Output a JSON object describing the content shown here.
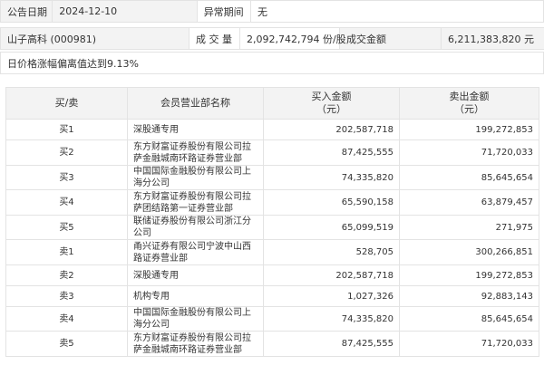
{
  "info": {
    "date_label": "公告日期",
    "date_value": "2024-12-10",
    "abnormal_label": "异常期间",
    "abnormal_value": "无",
    "stock_name": "山子高科 (000981)",
    "volume_label": "成 交 量",
    "volume_value": "2,092,742,794 份/股",
    "amount_label": "成交金额",
    "amount_value": "6,211,383,820 元",
    "reason": "日价格涨幅偏离值达到9.13%"
  },
  "table": {
    "headers": {
      "side": "买/卖",
      "broker": "会员营业部名称",
      "buy": "买入金额\n（元）",
      "sell": "卖出金额\n（元）"
    },
    "rows": [
      {
        "side": "买1",
        "broker": "深股通专用",
        "buy": "202,587,718",
        "sell": "199,272,853"
      },
      {
        "side": "买2",
        "broker": "东方财富证券股份有限公司拉萨金融城南环路证券营业部",
        "buy": "87,425,555",
        "sell": "71,720,033"
      },
      {
        "side": "买3",
        "broker": "中国国际金融股份有限公司上海分公司",
        "buy": "74,335,820",
        "sell": "85,645,654"
      },
      {
        "side": "买4",
        "broker": "东方财富证券股份有限公司拉萨团结路第一证券营业部",
        "buy": "65,590,158",
        "sell": "63,879,457"
      },
      {
        "side": "买5",
        "broker": "联储证券股份有限公司浙江分公司",
        "buy": "65,099,519",
        "sell": "271,975"
      },
      {
        "side": "卖1",
        "broker": "甬兴证券有限公司宁波中山西路证券营业部",
        "buy": "528,705",
        "sell": "300,266,851"
      },
      {
        "side": "卖2",
        "broker": "深股通专用",
        "buy": "202,587,718",
        "sell": "199,272,853"
      },
      {
        "side": "卖3",
        "broker": "机构专用",
        "buy": "1,027,326",
        "sell": "92,883,143"
      },
      {
        "side": "卖4",
        "broker": "中国国际金融股份有限公司上海分公司",
        "buy": "74,335,820",
        "sell": "85,645,654"
      },
      {
        "side": "卖5",
        "broker": "东方财富证券股份有限公司拉萨金融城南环路证券营业部",
        "buy": "87,425,555",
        "sell": "71,720,033"
      }
    ]
  }
}
